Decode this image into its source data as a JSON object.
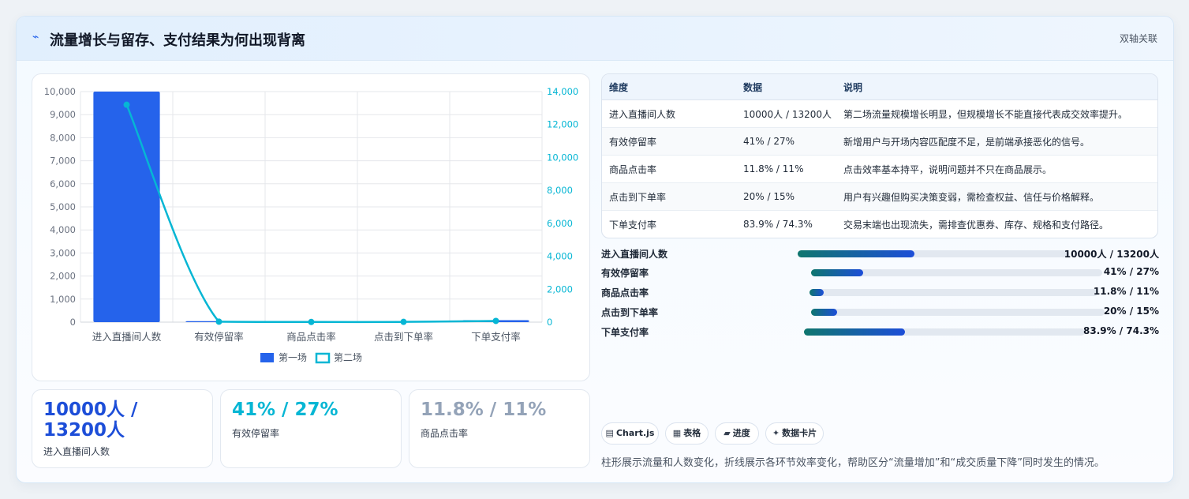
{
  "header": {
    "icon": "trend-icon",
    "title": "流量增长与留存、支付结果为何出现背离",
    "tag": "双轴关联"
  },
  "chart_data": {
    "type": "bar",
    "categories": [
      "进入直播间人数",
      "有效停留率",
      "商品点击率",
      "点击到下单率",
      "下单支付率"
    ],
    "series": [
      {
        "name": "第一场",
        "type": "bar",
        "axis": "left",
        "color": "#2563eb",
        "values": [
          10000,
          41,
          11.8,
          20,
          83.9
        ]
      },
      {
        "name": "第二场",
        "type": "line",
        "axis": "right",
        "color": "#06b6d4",
        "values": [
          13200,
          27,
          11,
          15,
          74.3
        ]
      }
    ],
    "y_left": {
      "min": 0,
      "max": 10000,
      "ticks": [
        "0",
        "1,000",
        "2,000",
        "3,000",
        "4,000",
        "5,000",
        "6,000",
        "7,000",
        "8,000",
        "9,000",
        "10,000"
      ]
    },
    "y_right": {
      "min": 0,
      "max": 14000,
      "ticks": [
        "0",
        "2,000",
        "4,000",
        "6,000",
        "8,000",
        "10,000",
        "12,000",
        "14,000"
      ]
    },
    "legend_position": "bottom",
    "grid": true
  },
  "kpis": [
    {
      "value": "10000人 / 13200人",
      "label": "进入直播间人数",
      "color": "#1d4ed8"
    },
    {
      "value": "41% / 27%",
      "label": "有效停留率",
      "color": "#06b6d4"
    },
    {
      "value": "11.8% / 11%",
      "label": "商品点击率",
      "color": "#94a3b8"
    }
  ],
  "table": {
    "headers": [
      "维度",
      "数据",
      "说明"
    ],
    "rows": [
      [
        "进入直播间人数",
        "10000人 / 13200人",
        "第二场流量规模增长明显，但规模增长不能直接代表成交效率提升。"
      ],
      [
        "有效停留率",
        "41% / 27%",
        "新增用户与开场内容匹配度不足，是前端承接恶化的信号。"
      ],
      [
        "商品点击率",
        "11.8% / 11%",
        "点击效率基本持平，说明问题并不只在商品展示。"
      ],
      [
        "点击到下单率",
        "20% / 15%",
        "用户有兴趣但购买决策变弱，需检查权益、信任与价格解释。"
      ],
      [
        "下单支付率",
        "83.9% / 74.3%",
        "交易末端也出现流失，需排查优惠券、库存、规格和支付路径。"
      ]
    ]
  },
  "progress": [
    {
      "label": "进入直播间人数",
      "value": "10000人 / 13200人",
      "fill": 0.43
    },
    {
      "label": "有效停留率",
      "value": "41% / 27%",
      "fill": 0.18
    },
    {
      "label": "商品点击率",
      "value": "11.8% / 11%",
      "fill": 0.05
    },
    {
      "label": "点击到下单率",
      "value": "20% / 15%",
      "fill": 0.09
    },
    {
      "label": "下单支付率",
      "value": "83.9% / 74.3%",
      "fill": 0.36
    }
  ],
  "chips": [
    {
      "icon": "bar-chart-icon",
      "label": "Chart.js"
    },
    {
      "icon": "table-icon",
      "label": "表格"
    },
    {
      "icon": "progress-icon",
      "label": "进度"
    },
    {
      "icon": "sparkle-icon",
      "label": "数据卡片"
    }
  ],
  "note": "柱形展示流量和人数变化，折线展示各环节效率变化，帮助区分“流量增加”和“成交质量下降”同时发生的情况。"
}
